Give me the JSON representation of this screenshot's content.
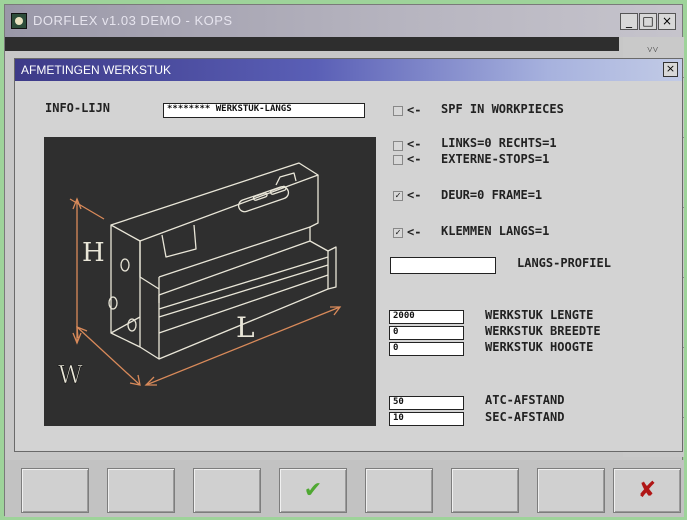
{
  "app": {
    "title": "DORFLEX v1.03   DEMO - KOPS",
    "minimize_label": "_",
    "maximize_label": "□",
    "close_label": "×"
  },
  "dialog": {
    "title": "AFMETINGEN WERKSTUK",
    "close_label": "×",
    "info_label": "INFO-LIJN",
    "info_value": "******** WERKSTUK-LANGS",
    "arrow": "<-",
    "options": [
      {
        "label": "SPF IN WORKPIECES",
        "checked": false
      },
      {
        "label": "LINKS=0 RECHTS=1",
        "checked": false
      },
      {
        "label": "EXTERNE-STOPS=1",
        "checked": false
      },
      {
        "label": "DEUR=0 FRAME=1",
        "checked": true
      },
      {
        "label": "KLEMMEN LANGS=1",
        "checked": true
      }
    ],
    "check_mark": "✓",
    "profile_label": "LANGS-PROFIEL",
    "profile_value": "",
    "dimensions": [
      {
        "value": "2000",
        "label": "WERKSTUK LENGTE"
      },
      {
        "value": "0",
        "label": "WERKSTUK BREEDTE"
      },
      {
        "value": "0",
        "label": "WERKSTUK HOOGTE"
      }
    ],
    "distances": [
      {
        "value": "50",
        "label": "ATC-AFSTAND"
      },
      {
        "value": "10",
        "label": "SEC-AFSTAND"
      }
    ],
    "illustration": {
      "h": "H",
      "l": "L",
      "w": "W"
    }
  },
  "toolbar": {
    "ok_symbol": "✔",
    "cancel_symbol": "✘"
  },
  "colors": {
    "ok": "#4fa832",
    "cancel": "#b01616",
    "title_gradient_start": "#3d3a88",
    "drawing_lines": "#e9e6d8",
    "drawing_arrows": "#d98a5a"
  }
}
